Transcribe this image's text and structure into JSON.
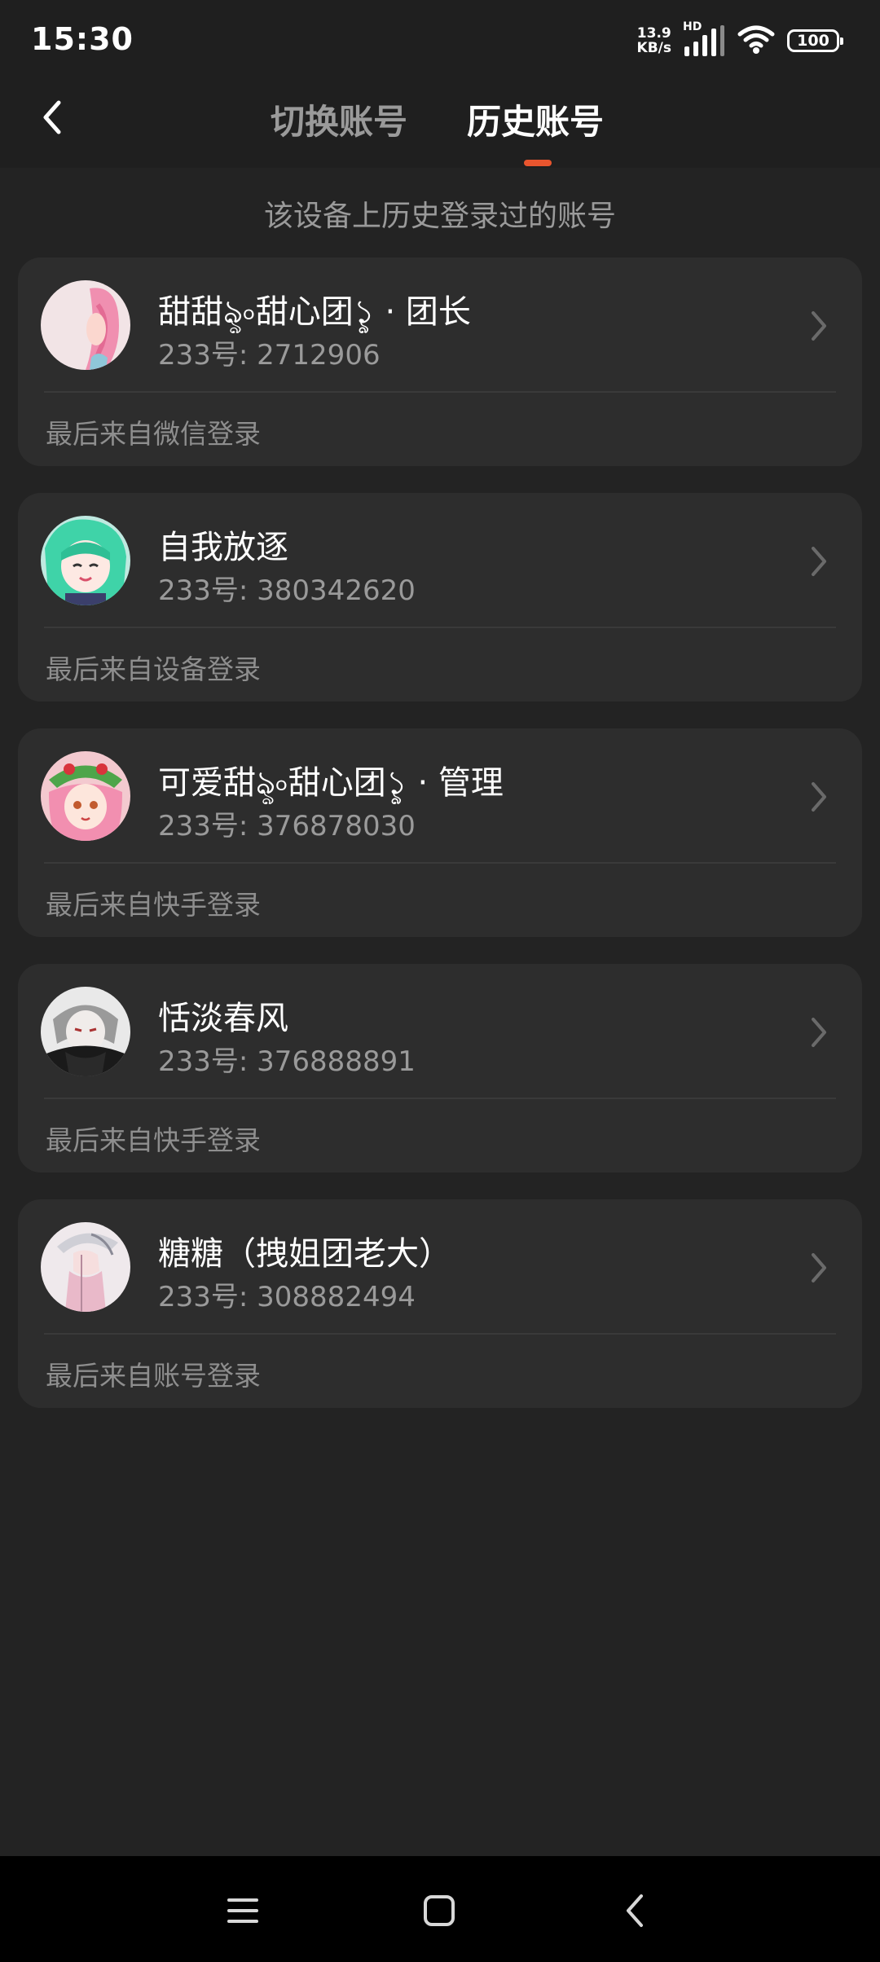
{
  "status_bar": {
    "time": "15:30",
    "net_speed_value": "13.9",
    "net_speed_unit": "KB/s",
    "hd_label": "HD",
    "battery": "100"
  },
  "header": {
    "tabs": [
      {
        "label": "切换账号",
        "active": false
      },
      {
        "label": "历史账号",
        "active": true
      }
    ],
    "accent_color": "#e8552e"
  },
  "subtitle": "该设备上历史登录过的账号",
  "accounts": [
    {
      "name": "甜甜ৡ৹甜心团১ৢ · 团长",
      "id": "233号: 2712906",
      "source": "最后来自微信登录"
    },
    {
      "name": "自我放逐",
      "id": "233号: 380342620",
      "source": "最后来自设备登录"
    },
    {
      "name": "可爱甜ৡ৹甜心团১ৢ · 管理",
      "id": "233号: 376878030",
      "source": "最后来自快手登录"
    },
    {
      "name": "恬淡春风",
      "id": "233号: 376888891",
      "source": "最后来自快手登录"
    },
    {
      "name": "糖糖（拽姐团老大）",
      "id": "233号: 308882494",
      "source": "最后来自账号登录"
    }
  ],
  "nav": {
    "icons": [
      "menu-icon",
      "home-icon",
      "back-icon"
    ]
  }
}
